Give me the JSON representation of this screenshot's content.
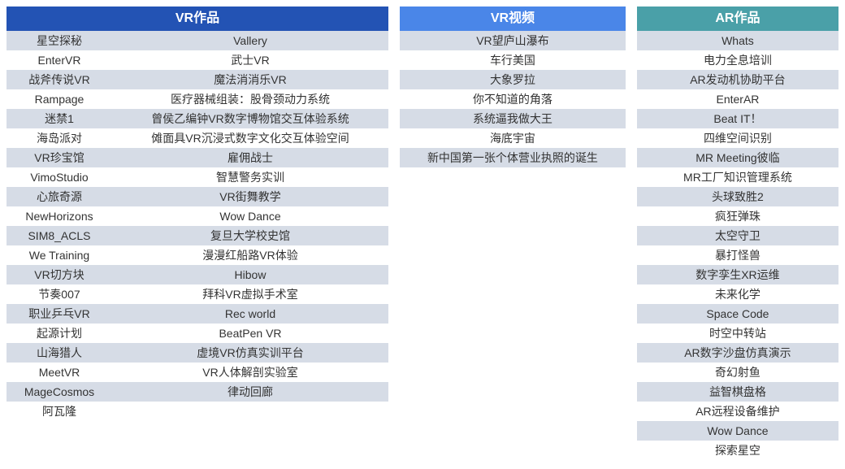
{
  "headers": {
    "vrworks": "VR作品",
    "vrvideo": "VR视频",
    "arworks": "AR作品"
  },
  "vrworks": [
    {
      "c1": "星空探秘",
      "c2": "Vallery"
    },
    {
      "c1": "EnterVR",
      "c2": "武士VR"
    },
    {
      "c1": "战斧传说VR",
      "c2": "魔法消消乐VR"
    },
    {
      "c1": "Rampage",
      "c2": "医疗器械组装：股骨颈动力系统"
    },
    {
      "c1": "迷禁1",
      "c2": "曾侯乙编钟VR数字博物馆交互体验系统"
    },
    {
      "c1": "海岛派对",
      "c2": "傩面具VR沉浸式数字文化交互体验空间"
    },
    {
      "c1": "VR珍宝馆",
      "c2": "雇佣战士"
    },
    {
      "c1": "VimoStudio",
      "c2": "智慧警务实训"
    },
    {
      "c1": "心旅奇源",
      "c2": "VR街舞教学"
    },
    {
      "c1": "NewHorizons",
      "c2": "Wow Dance"
    },
    {
      "c1": "SIM8_ACLS",
      "c2": "复旦大学校史馆"
    },
    {
      "c1": "We Training",
      "c2": "漫漫红船路VR体验"
    },
    {
      "c1": "VR切方块",
      "c2": "Hibow"
    },
    {
      "c1": "节奏007",
      "c2": "拜科VR虚拟手术室"
    },
    {
      "c1": "职业乒乓VR",
      "c2": "Rec world"
    },
    {
      "c1": "起源计划",
      "c2": "BeatPen VR"
    },
    {
      "c1": "山海猎人",
      "c2": "虚境VR仿真实训平台"
    },
    {
      "c1": "MeetVR",
      "c2": "VR人体解剖实验室"
    },
    {
      "c1": "MageCosmos",
      "c2": "律动回廊"
    },
    {
      "c1": "阿瓦隆",
      "c2": ""
    }
  ],
  "vrvideo": [
    "VR望庐山瀑布",
    "车行美国",
    "大象罗拉",
    "你不知道的角落",
    "系统逼我做大王",
    "海底宇宙",
    "新中国第一张个体营业执照的诞生"
  ],
  "arworks": [
    "Whats",
    "电力全息培训",
    "AR发动机协助平台",
    "EnterAR",
    "Beat IT！",
    "四维空间识别",
    "MR Meeting彼临",
    "MR工厂知识管理系统",
    "头球致胜2",
    "疯狂弹珠",
    "太空守卫",
    "暴打怪兽",
    "数字孪生XR运维",
    "未来化学",
    "Space Code",
    "时空中转站",
    "AR数字沙盘仿真演示",
    "奇幻射鱼",
    "益智棋盘格",
    "AR远程设备维护",
    "Wow Dance",
    "探索星空"
  ]
}
